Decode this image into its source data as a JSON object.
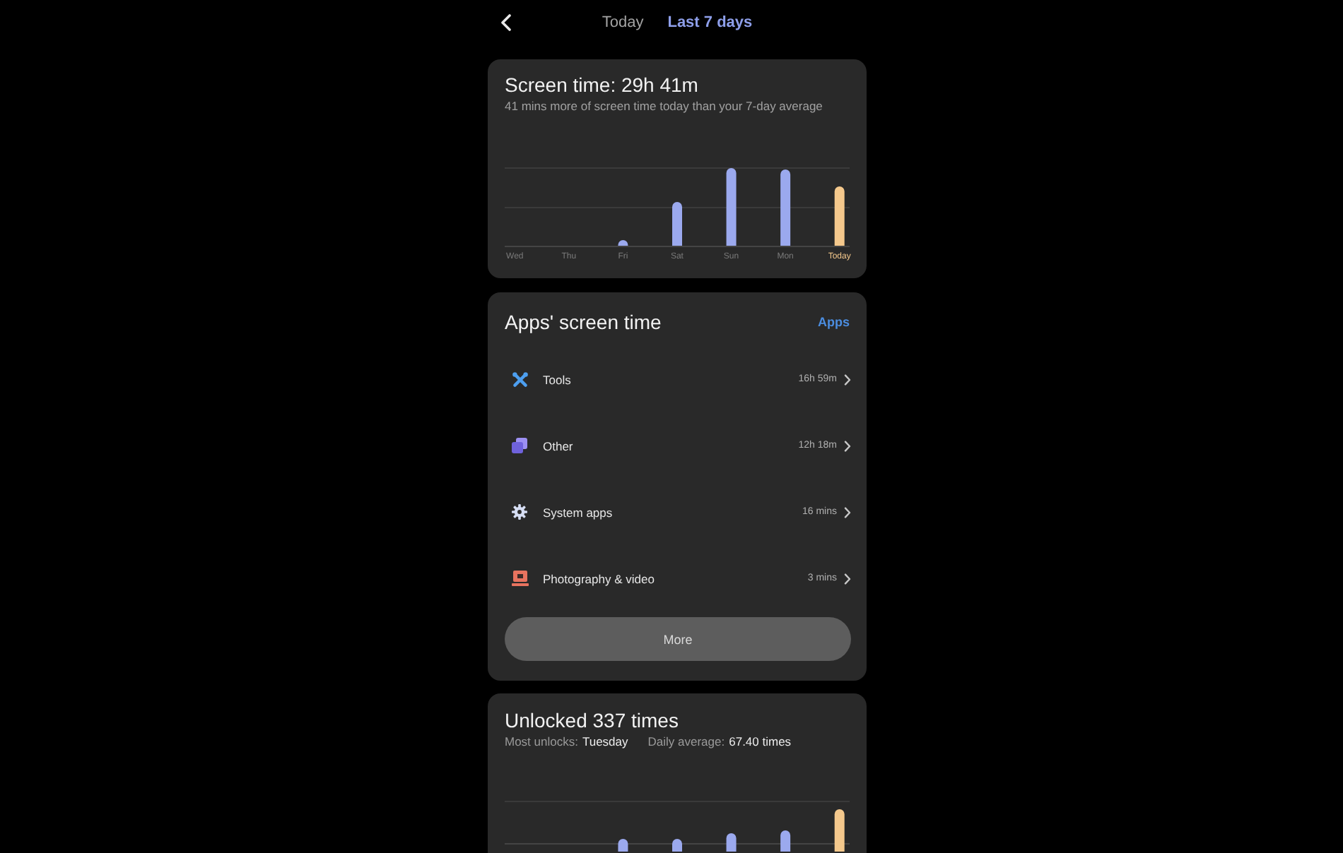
{
  "header": {
    "tabs": [
      {
        "label": "Today",
        "selected": false
      },
      {
        "label": "Last 7 days",
        "selected": true
      }
    ]
  },
  "screen_time": {
    "title": "Screen time: 29h 41m",
    "subtitle": "41 mins more of screen time today than your 7-day average",
    "days": [
      {
        "label": "Wed",
        "current": false
      },
      {
        "label": "Thu",
        "current": false
      },
      {
        "label": "Fri",
        "current": false
      },
      {
        "label": "Sat",
        "current": false
      },
      {
        "label": "Sun",
        "current": false
      },
      {
        "label": "Mon",
        "current": false
      },
      {
        "label": "Today",
        "current": true
      }
    ]
  },
  "apps_screen_time": {
    "title": "Apps' screen time",
    "link": "Apps",
    "apps": [
      {
        "kind": "tools",
        "name": "Tools",
        "time": "16h 59m"
      },
      {
        "kind": "other",
        "name": "Other",
        "time": "12h 18m"
      },
      {
        "kind": "system",
        "name": "System apps",
        "time": "16 mins"
      },
      {
        "kind": "photo",
        "name": "Photography & video",
        "time": "3 mins"
      }
    ],
    "more_button": "More"
  },
  "unlocks": {
    "title": "Unlocked 337 times",
    "stats": [
      {
        "label": "Most unlocks:",
        "value": "Tuesday"
      },
      {
        "label": "Daily average:",
        "value": "67.40 times"
      }
    ]
  }
}
